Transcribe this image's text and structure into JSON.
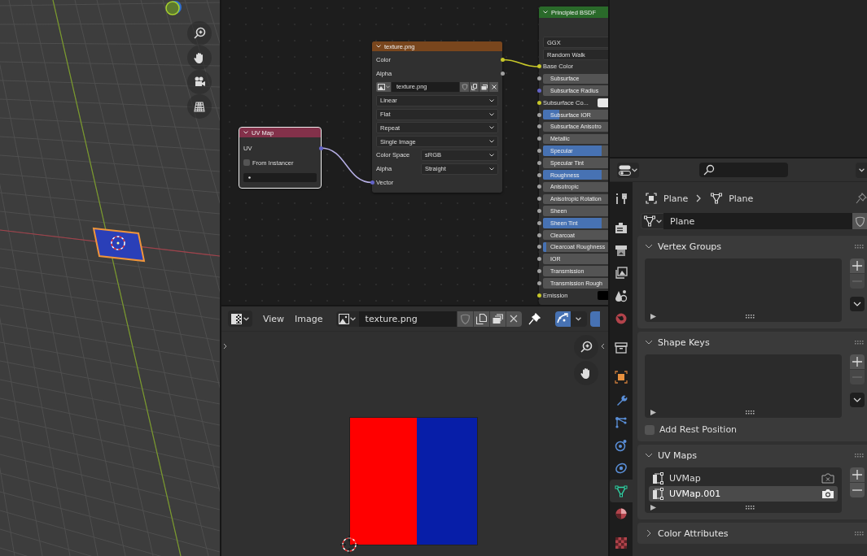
{
  "node_editor": {
    "nodes": [
      {
        "title": "UV Map",
        "color": "#83314a",
        "selected": true,
        "rows": [
          {
            "kind": "output",
            "label": "UV",
            "color": "#6363c7"
          },
          {
            "kind": "checkbox",
            "label": "From Instancer",
            "checked": false
          },
          {
            "kind": "search_field"
          }
        ]
      },
      {
        "title": "texture.png",
        "color": "#79461d",
        "selected": false,
        "rows": [
          {
            "kind": "output",
            "label": "Color",
            "color": "#c7c729"
          },
          {
            "kind": "output",
            "label": "Alpha",
            "color": "#a1a1a1"
          },
          {
            "kind": "image_field",
            "value": "texture.png"
          },
          {
            "kind": "dropdown",
            "value": "Linear"
          },
          {
            "kind": "dropdown",
            "value": "Flat"
          },
          {
            "kind": "dropdown",
            "value": "Repeat"
          },
          {
            "kind": "dropdown",
            "value": "Single Image"
          },
          {
            "kind": "labeled_dropdown",
            "label": "Color Space",
            "value": "sRGB"
          },
          {
            "kind": "labeled_dropdown",
            "label": "Alpha",
            "value": "Straight"
          },
          {
            "kind": "input",
            "label": "Vector",
            "color": "#6363c7"
          }
        ]
      },
      {
        "title": "Principled BSDF",
        "color": "#2a6a2a",
        "selected": false,
        "rows": [
          {
            "kind": "dropdown",
            "value": "GGX"
          },
          {
            "kind": "dropdown",
            "value": "Random Walk"
          },
          {
            "kind": "input",
            "label": "Base Color",
            "color": "#c7c729"
          },
          {
            "kind": "slider",
            "label": "Subsurface",
            "color": "#a1a1a1",
            "level": 0
          },
          {
            "kind": "field",
            "label": "Subsurface Radius",
            "color": "#6363c7"
          },
          {
            "kind": "color_input",
            "label": "Subsurface Co...",
            "color": "#c7c729",
            "swatch": {
              "color": "#e6e6e6"
            }
          },
          {
            "kind": "slider",
            "label": "Subsurface IOR",
            "color": "#a1a1a1",
            "level": 0.15
          },
          {
            "kind": "slider",
            "label": "Subsurface Anisotro",
            "color": "#a1a1a1",
            "level": 0
          },
          {
            "kind": "slider",
            "label": "Metallic",
            "color": "#a1a1a1",
            "level": 0
          },
          {
            "kind": "slider",
            "label": "Specular",
            "color": "#a1a1a1",
            "level": 0.55
          },
          {
            "kind": "slider",
            "label": "Specular Tint",
            "color": "#a1a1a1",
            "level": 0
          },
          {
            "kind": "slider",
            "label": "Roughness",
            "color": "#a1a1a1",
            "level": 0.55
          },
          {
            "kind": "slider",
            "label": "Anisotropic",
            "color": "#a1a1a1",
            "level": 0
          },
          {
            "kind": "slider",
            "label": "Anisotropic Rotation",
            "color": "#a1a1a1",
            "level": 0
          },
          {
            "kind": "slider",
            "label": "Sheen",
            "color": "#a1a1a1",
            "level": 0
          },
          {
            "kind": "slider",
            "label": "Sheen Tint",
            "color": "#a1a1a1",
            "level": 0.55
          },
          {
            "kind": "slider",
            "label": "Clearcoat",
            "color": "#a1a1a1",
            "level": 0
          },
          {
            "kind": "slider",
            "label": "Clearcoat Roughness",
            "color": "#a1a1a1",
            "level": 0.03
          },
          {
            "kind": "field",
            "label": "IOR",
            "color": "#a1a1a1"
          },
          {
            "kind": "slider",
            "label": "Transmission",
            "color": "#a1a1a1",
            "level": 0
          },
          {
            "kind": "slider",
            "label": "Transmission Rough",
            "color": "#a1a1a1",
            "level": 0
          },
          {
            "kind": "color_input",
            "label": "Emission",
            "color": "#c7c729",
            "swatch": {
              "color": "#000000"
            }
          }
        ]
      }
    ]
  },
  "image_editor": {
    "menus": [
      {
        "label": "View"
      },
      {
        "label": "Image"
      }
    ],
    "image_name": "texture.png",
    "curve_toggle": {
      "on": true
    }
  },
  "properties": {
    "tabs": [
      {
        "selected": false
      },
      {
        "selected": false
      },
      {
        "selected": false
      },
      {
        "selected": false
      },
      {
        "selected": false
      },
      {
        "selected": false
      },
      {
        "selected": false
      },
      {
        "selected": false
      },
      {
        "selected": false
      },
      {
        "selected": false
      },
      {
        "selected": false
      },
      {
        "selected": false
      },
      {
        "selected": true
      },
      {
        "selected": false
      },
      {
        "selected": false
      }
    ],
    "breadcrumb": [
      "Plane",
      "Plane"
    ],
    "data_block": "Plane",
    "panels": [
      {
        "title": "Vertex Groups",
        "expanded": true,
        "minus_enabled": false,
        "specials_menu": true
      },
      {
        "title": "Shape Keys",
        "expanded": true,
        "minus_enabled": false,
        "specials_menu": true,
        "checkbox": {
          "label": "Add Rest Position",
          "checked": false
        }
      },
      {
        "title": "UV Maps",
        "expanded": true,
        "minus_enabled": true,
        "specials_menu": false,
        "items": [
          {
            "label": "UVMap",
            "selected": false,
            "active_render": false
          },
          {
            "label": "UVMap.001",
            "selected": true,
            "active_render": true
          }
        ]
      },
      {
        "title": "Color Attributes",
        "expanded": false
      }
    ]
  }
}
